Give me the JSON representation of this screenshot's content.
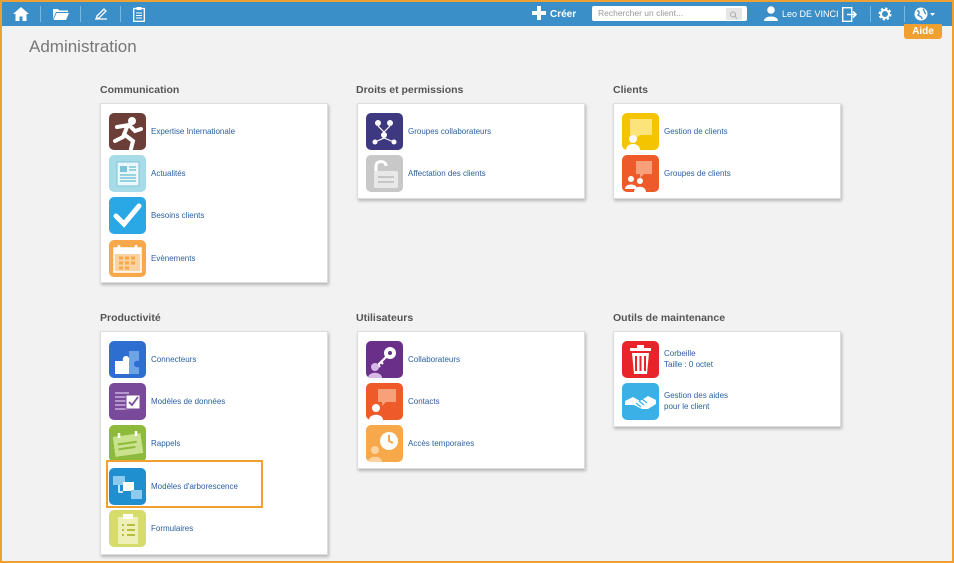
{
  "header": {
    "create_label": "Créer",
    "search_placeholder": "Rechercher un client...",
    "user_name": "Leo DE VINCI",
    "help_label": "Aide",
    "icons": [
      "home-icon",
      "folder-icon",
      "edit-icon",
      "clipboard-icon",
      "plus-icon",
      "search-icon",
      "user-icon",
      "logout-icon",
      "gear-icon",
      "globe-icon"
    ]
  },
  "page": {
    "title": "Administration"
  },
  "sections": {
    "communication": {
      "title": "Communication",
      "items": [
        {
          "label": "Expertise Internationale"
        },
        {
          "label": "Actualités"
        },
        {
          "label": "Besoins clients"
        },
        {
          "label": "Evènements"
        }
      ]
    },
    "droits": {
      "title": "Droits et permissions",
      "items": [
        {
          "label": "Groupes collaborateurs"
        },
        {
          "label": "Affectation des clients"
        }
      ]
    },
    "clients": {
      "title": "Clients",
      "items": [
        {
          "label": "Gestion de clients"
        },
        {
          "label": "Groupes de clients"
        }
      ]
    },
    "productivite": {
      "title": "Productivité",
      "items": [
        {
          "label": "Connecteurs"
        },
        {
          "label": "Modèles de données"
        },
        {
          "label": "Rappels"
        },
        {
          "label": "Modèles d'arborescence"
        },
        {
          "label": "Formulaires"
        }
      ]
    },
    "utilisateurs": {
      "title": "Utilisateurs",
      "items": [
        {
          "label": "Collaborateurs"
        },
        {
          "label": "Contacts"
        },
        {
          "label": "Accès temporaires"
        }
      ]
    },
    "maintenance": {
      "title": "Outils de maintenance",
      "items": [
        {
          "label": "Corbeille",
          "sub": "Taille : 0 octet"
        },
        {
          "label": "Gestion des aides",
          "sub": "pour le client"
        }
      ]
    }
  },
  "colors": {
    "topbar": "#3a8fc9",
    "accent": "#f0a030",
    "link": "#2a5fa0"
  }
}
